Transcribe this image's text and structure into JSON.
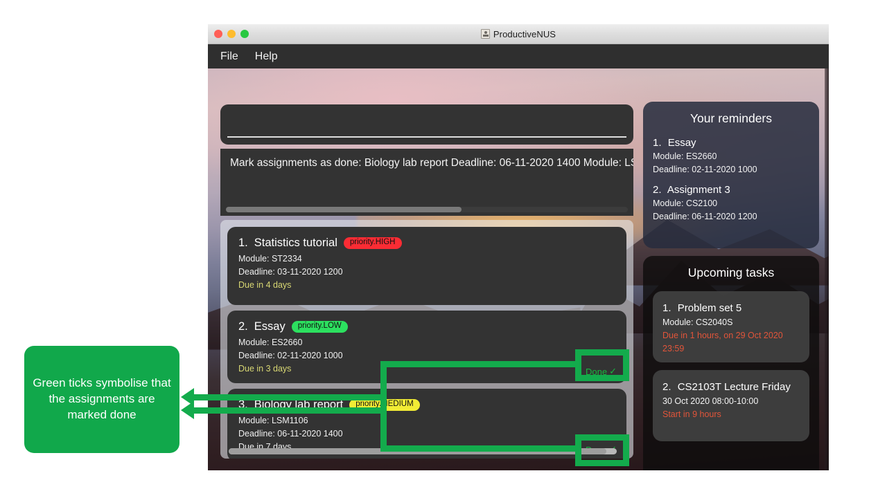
{
  "window": {
    "title": "ProductiveNUS",
    "title_icon": "app-person-icon",
    "traffic_lights": [
      "close-red",
      "minimize-yellow",
      "zoom-green"
    ]
  },
  "menubar": {
    "items": [
      {
        "label": "File"
      },
      {
        "label": "Help"
      }
    ]
  },
  "command_box": {
    "value": "",
    "placeholder": ""
  },
  "feedback_box": {
    "text": "Mark assignments as done: Biology lab report Deadline: 06-11-2020 1400 Module: LS"
  },
  "assignments": {
    "items": [
      {
        "index": "1.",
        "name": "Statistics tutorial",
        "priority": "priority.HIGH",
        "priority_color": "#fa2c34",
        "module": "Module: ST2334",
        "deadline": "Deadline: 03-11-2020 1200",
        "due": "Due in 4 days",
        "due_color": "#d8d773",
        "done": "",
        "done_visible": false
      },
      {
        "index": "2.",
        "name": "Essay",
        "priority": "priority.LOW",
        "priority_color": "#2ce05f",
        "module": "Module: ES2660",
        "deadline": "Deadline: 02-11-2020 1000",
        "due": "Due in 3 days",
        "due_color": "#d8d773",
        "done": "Done",
        "done_visible": true
      },
      {
        "index": "3.",
        "name": "Biology lab report",
        "priority": "priority.MEDIUM",
        "priority_color": "#f2ec35",
        "module": "Module: LSM1106",
        "deadline": "Deadline: 06-11-2020 1400",
        "due": "Due in 7 days",
        "due_color": "#f0f0f0",
        "done": "Done",
        "done_visible": true
      }
    ],
    "done_check_glyph": "✓"
  },
  "reminders": {
    "heading": "Your reminders",
    "items": [
      {
        "index": "1.",
        "name": "Essay",
        "module": "Module: ES2660",
        "deadline": "Deadline: 02-11-2020 1000"
      },
      {
        "index": "2.",
        "name": "Assignment 3",
        "module": "Module: CS2100",
        "deadline": "Deadline: 06-11-2020 1200"
      }
    ]
  },
  "upcoming": {
    "heading": "Upcoming tasks",
    "items": [
      {
        "index": "1.",
        "name": "Problem set 5",
        "line2": "Module: CS2040S",
        "warn": "Due in 1 hours, on 29 Oct 2020 23:59",
        "warn_color": "#e2553a"
      },
      {
        "index": "2.",
        "name": "CS2103T Lecture Friday",
        "line2": "30 Oct 2020 08:00-10:00",
        "warn": "Start in 9 hours",
        "warn_color": "#e2553a"
      }
    ]
  },
  "annotation": {
    "callout_text": "Green ticks symbolise that the assignments are marked done",
    "accent_color": "#13ab4c",
    "callout_bg": "#11a84b"
  }
}
